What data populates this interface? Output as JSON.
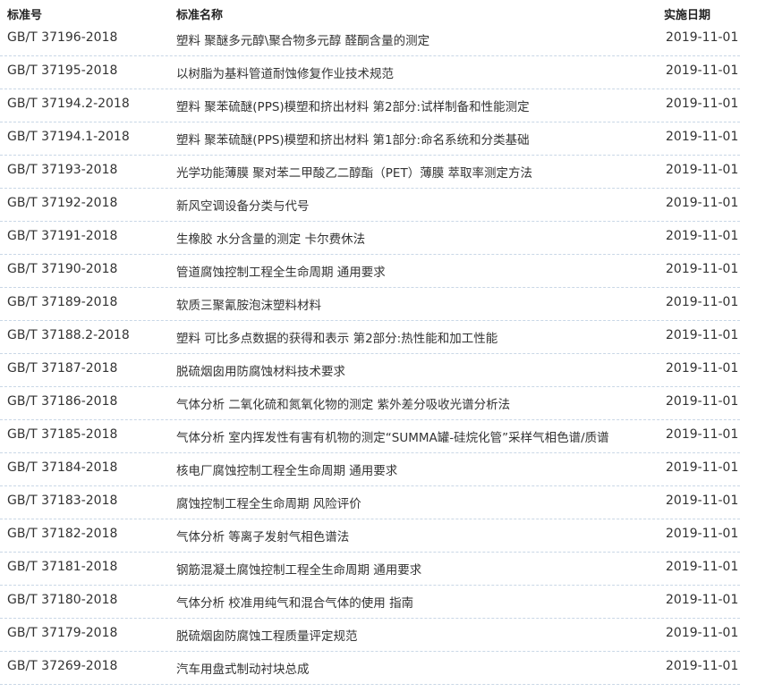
{
  "header": {
    "code": "标准号",
    "name": "标准名称",
    "date": "实施日期"
  },
  "rows": [
    {
      "code": "GB/T 37196-2018",
      "name": "塑料 聚醚多元醇\\聚合物多元醇 醛酮含量的测定",
      "date": "2019-11-01"
    },
    {
      "code": "GB/T 37195-2018",
      "name": "以树脂为基料管道耐蚀修复作业技术规范",
      "date": "2019-11-01"
    },
    {
      "code": "GB/T 37194.2-2018",
      "name": "塑料 聚苯硫醚(PPS)模塑和挤出材料 第2部分:试样制备和性能测定",
      "date": "2019-11-01"
    },
    {
      "code": "GB/T 37194.1-2018",
      "name": "塑料 聚苯硫醚(PPS)模塑和挤出材料 第1部分:命名系统和分类基础",
      "date": "2019-11-01"
    },
    {
      "code": "GB/T 37193-2018",
      "name": "光学功能薄膜 聚对苯二甲酸乙二醇酯（PET）薄膜 萃取率测定方法",
      "date": "2019-11-01"
    },
    {
      "code": "GB/T 37192-2018",
      "name": "新风空调设备分类与代号",
      "date": "2019-11-01"
    },
    {
      "code": "GB/T 37191-2018",
      "name": "生橡胶 水分含量的测定 卡尔费休法",
      "date": "2019-11-01"
    },
    {
      "code": "GB/T 37190-2018",
      "name": "管道腐蚀控制工程全生命周期 通用要求",
      "date": "2019-11-01"
    },
    {
      "code": "GB/T 37189-2018",
      "name": "软质三聚氰胺泡沫塑料材料",
      "date": "2019-11-01"
    },
    {
      "code": "GB/T 37188.2-2018",
      "name": "塑料 可比多点数据的获得和表示 第2部分:热性能和加工性能",
      "date": "2019-11-01"
    },
    {
      "code": "GB/T 37187-2018",
      "name": "脱硫烟囱用防腐蚀材料技术要求",
      "date": "2019-11-01"
    },
    {
      "code": "GB/T 37186-2018",
      "name": "气体分析 二氧化硫和氮氧化物的测定 紫外差分吸收光谱分析法",
      "date": "2019-11-01"
    },
    {
      "code": "GB/T 37185-2018",
      "name": "气体分析 室内挥发性有害有机物的测定“SUMMA罐-硅烷化管”采样气相色谱/质谱",
      "date": "2019-11-01"
    },
    {
      "code": "GB/T 37184-2018",
      "name": "核电厂腐蚀控制工程全生命周期 通用要求",
      "date": "2019-11-01"
    },
    {
      "code": "GB/T 37183-2018",
      "name": "腐蚀控制工程全生命周期 风险评价",
      "date": "2019-11-01"
    },
    {
      "code": "GB/T 37182-2018",
      "name": "气体分析 等离子发射气相色谱法",
      "date": "2019-11-01"
    },
    {
      "code": "GB/T 37181-2018",
      "name": "钢筋混凝土腐蚀控制工程全生命周期 通用要求",
      "date": "2019-11-01"
    },
    {
      "code": "GB/T 37180-2018",
      "name": "气体分析 校准用纯气和混合气体的使用 指南",
      "date": "2019-11-01"
    },
    {
      "code": "GB/T 37179-2018",
      "name": "脱硫烟囱防腐蚀工程质量评定规范",
      "date": "2019-11-01"
    },
    {
      "code": "GB/T 37269-2018",
      "name": "汽车用盘式制动衬块总成",
      "date": "2019-11-01"
    }
  ]
}
